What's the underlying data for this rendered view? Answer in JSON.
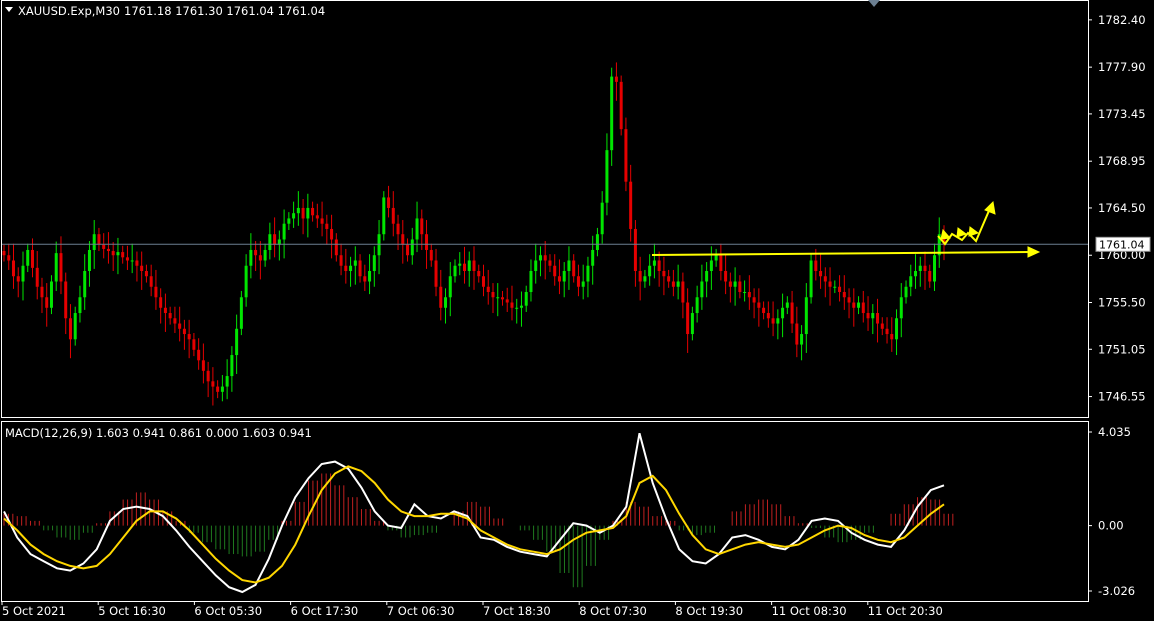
{
  "chart_data": [
    {
      "type": "candlestick",
      "title": "XAUUSD.Exp,M30",
      "ohlc_label": "1761.18 1761.30 1761.04 1761.04",
      "ylim": [
        1744.7,
        1784.1
      ],
      "y_ticks": [
        "1782.40",
        "1777.90",
        "1773.45",
        "1768.95",
        "1764.50",
        "1760.00",
        "1755.50",
        "1751.05",
        "1746.55"
      ],
      "y_tick_values": [
        1782.4,
        1777.9,
        1773.45,
        1768.95,
        1764.5,
        1760.0,
        1755.5,
        1751.05,
        1746.55
      ],
      "current_price": "1761.04",
      "x_ticks": [
        "5 Oct 2021",
        "5 Oct 16:30",
        "6 Oct 05:30",
        "6 Oct 17:30",
        "7 Oct 06:30",
        "7 Oct 18:30",
        "8 Oct 07:30",
        "8 Oct 19:30",
        "11 Oct 08:30",
        "11 Oct 20:30"
      ],
      "closes": [
        1760,
        1759.5,
        1758,
        1757.5,
        1759,
        1760.5,
        1758.8,
        1757,
        1756,
        1755,
        1757.5,
        1760.2,
        1757.5,
        1754,
        1752,
        1754.5,
        1756,
        1758.5,
        1760.5,
        1762,
        1761,
        1760.6,
        1760.4,
        1760,
        1760.3,
        1759.8,
        1759.5,
        1759.5,
        1759,
        1758.5,
        1758,
        1757,
        1756,
        1755,
        1754.5,
        1754,
        1753.5,
        1753,
        1752.5,
        1752,
        1751,
        1750,
        1749,
        1748,
        1747.5,
        1747,
        1747.5,
        1748.5,
        1750.5,
        1753,
        1756,
        1759,
        1760.5,
        1760,
        1759.5,
        1760.5,
        1762,
        1761,
        1761.5,
        1763,
        1763.5,
        1764,
        1764.5,
        1763.5,
        1764.5,
        1763.8,
        1763.5,
        1763,
        1762.5,
        1761.5,
        1760,
        1759,
        1758.5,
        1759,
        1759.5,
        1758,
        1757.5,
        1758.5,
        1760,
        1762,
        1765.5,
        1764.5,
        1763,
        1762,
        1761,
        1760,
        1761.5,
        1763.5,
        1762,
        1760.5,
        1759.5,
        1757,
        1755,
        1756,
        1758,
        1759,
        1759.2,
        1758.5,
        1759.5,
        1758.5,
        1758,
        1757,
        1756.5,
        1756,
        1756,
        1755.8,
        1755.5,
        1755,
        1755,
        1755.2,
        1756.5,
        1758.5,
        1759.5,
        1760,
        1759.5,
        1759,
        1758,
        1757.5,
        1758.5,
        1759.5,
        1758,
        1757,
        1757.5,
        1759,
        1760.5,
        1762,
        1765,
        1770,
        1777,
        1776.5,
        1772,
        1767,
        1762.5,
        1758.5,
        1757.5,
        1758,
        1759,
        1759.5,
        1758.5,
        1758,
        1757.5,
        1757,
        1757.5,
        1755.5,
        1752.5,
        1754.5,
        1756,
        1757.5,
        1758.5,
        1759.5,
        1760,
        1758.5,
        1757.5,
        1757,
        1757.5,
        1756.5,
        1756.5,
        1756,
        1755.5,
        1755,
        1754.5,
        1754,
        1753.5,
        1754,
        1755,
        1755.5,
        1753.5,
        1751.5,
        1752.5,
        1756,
        1759.5,
        1758.5,
        1758,
        1757.5,
        1757,
        1757,
        1756.5,
        1756,
        1755.5,
        1755,
        1755.5,
        1754.5,
        1754,
        1754.5,
        1753.5,
        1753,
        1752.5,
        1752,
        1754,
        1756,
        1757,
        1758,
        1758.5,
        1759,
        1758.5,
        1757.5,
        1760,
        1762,
        1761.04
      ],
      "macd": {
        "label": "MACD(12,26,9) 1.603 0.941 0.861 0.000 1.603 0.941",
        "ylim": [
          -3.026,
          4.035
        ],
        "y_ticks": [
          "4.035",
          "0.00",
          "-3.026"
        ],
        "y_tick_values": [
          4.035,
          0,
          -3.026
        ],
        "histogram": [
          0.5,
          0.4,
          0.2,
          -0.2,
          -0.5,
          -0.6,
          -0.3,
          0.1,
          0.6,
          1.1,
          1.4,
          1.1,
          0.6,
          0.2,
          -0.3,
          -0.7,
          -1.0,
          -1.2,
          -1.3,
          -1.1,
          -0.6,
          0.2,
          1.0,
          1.9,
          2.2,
          1.7,
          1.2,
          0.7,
          0.2,
          -0.2,
          -0.5,
          -0.4,
          -0.3,
          0.0,
          0.6,
          1.0,
          0.8,
          0.3,
          0.0,
          -0.2,
          -0.6,
          -1.1,
          -2.0,
          -2.6,
          -1.7,
          -0.6,
          0.2,
          1.0,
          0.8,
          0.4,
          0.2,
          -0.2,
          -0.4,
          -0.3,
          0.0,
          0.6,
          0.9,
          1.1,
          0.9,
          0.4,
          0.1,
          -0.1,
          -0.5,
          -0.7,
          -0.6,
          -0.3,
          0.0,
          0.5,
          0.9,
          1.2,
          1.1,
          0.5
        ],
        "macd_line": [
          0.6,
          -0.5,
          -1.2,
          -1.5,
          -1.8,
          -1.9,
          -1.6,
          -1.0,
          0.2,
          0.7,
          0.8,
          0.7,
          0.4,
          -0.2,
          -0.9,
          -1.5,
          -2.1,
          -2.6,
          -2.8,
          -2.5,
          -1.4,
          0.0,
          1.2,
          2.0,
          2.6,
          2.7,
          2.4,
          1.6,
          0.6,
          0.0,
          -0.1,
          0.9,
          0.4,
          0.3,
          0.6,
          0.4,
          -0.5,
          -0.6,
          -0.9,
          -1.1,
          -1.2,
          -1.3,
          -0.6,
          0.1,
          0.0,
          -0.3,
          0.0,
          0.8,
          3.9,
          1.8,
          0.3,
          -1.0,
          -1.5,
          -1.6,
          -1.2,
          -0.5,
          -0.4,
          -0.6,
          -0.9,
          -1.0,
          -0.6,
          0.2,
          0.3,
          0.2,
          -0.3,
          -0.6,
          -0.8,
          -0.9,
          -0.2,
          0.8,
          1.5,
          1.7
        ],
        "signal_line": [
          0.3,
          -0.2,
          -0.8,
          -1.2,
          -1.5,
          -1.7,
          -1.8,
          -1.7,
          -1.2,
          -0.5,
          0.2,
          0.6,
          0.6,
          0.3,
          -0.2,
          -0.8,
          -1.4,
          -1.9,
          -2.3,
          -2.4,
          -2.2,
          -1.7,
          -0.8,
          0.4,
          1.5,
          2.2,
          2.5,
          2.3,
          1.8,
          1.1,
          0.6,
          0.4,
          0.4,
          0.5,
          0.5,
          0.3,
          -0.2,
          -0.5,
          -0.8,
          -1.0,
          -1.1,
          -1.2,
          -1.0,
          -0.6,
          -0.3,
          -0.2,
          -0.1,
          0.4,
          1.8,
          2.1,
          1.5,
          0.5,
          -0.4,
          -1.0,
          -1.2,
          -1.0,
          -0.8,
          -0.7,
          -0.8,
          -0.9,
          -0.8,
          -0.5,
          -0.2,
          0.0,
          -0.1,
          -0.4,
          -0.6,
          -0.7,
          -0.5,
          0.0,
          0.5,
          0.9
        ]
      }
    }
  ],
  "colors": {
    "bull": "#00e600",
    "bear": "#e60000",
    "macd_line": "#ffffff",
    "signal_line": "#ffd700",
    "annotation": "#ffff00",
    "price_line": "#6c7f91",
    "frame": "#ffffff"
  }
}
